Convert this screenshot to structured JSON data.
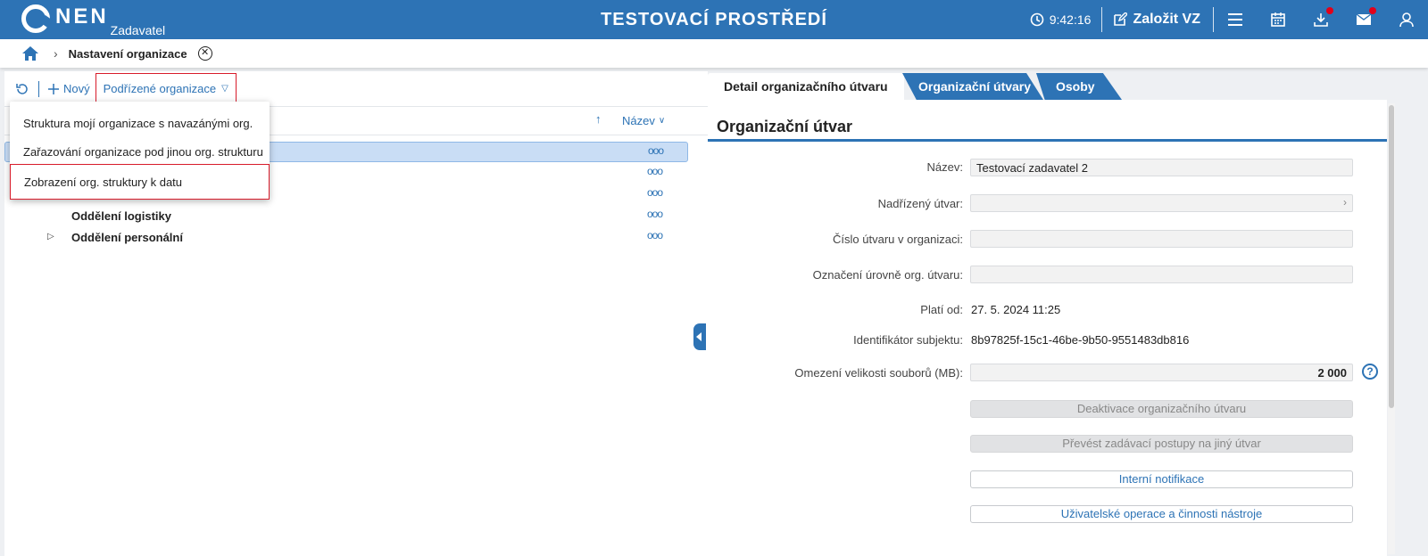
{
  "app": {
    "logo_text": "NEN",
    "logo_subtitle": "Zadavatel",
    "environment_title": "TESTOVACÍ PROSTŘEDÍ",
    "time": "9:42:16",
    "create_label": "Založit VZ",
    "icons": [
      "clock-icon",
      "edit-icon",
      "menu-icon",
      "calendar-icon",
      "download-icon",
      "mail-icon",
      "user-icon"
    ]
  },
  "breadcrumb": {
    "current": "Nastavení organizace"
  },
  "toolbar": {
    "new_label": "Nový",
    "subordinate_label": "Podřízené organizace"
  },
  "tree": {
    "sort_label": "Název",
    "rows": [
      {
        "label": "",
        "toggle": false,
        "selected": true
      },
      {
        "label": "",
        "toggle": false,
        "selected": false
      },
      {
        "label": "",
        "toggle": false,
        "selected": false
      },
      {
        "label": "Oddělení logistiky",
        "toggle": false,
        "selected": false
      },
      {
        "label": "Oddělení personální",
        "toggle": true,
        "selected": false
      }
    ],
    "more_symbol": "ooo"
  },
  "dropdown": {
    "items": [
      "Struktura mojí organizace s navazánými org.",
      "Zařazování organizace pod jinou org. strukturu",
      "Zobrazení org. struktury k datu"
    ]
  },
  "tabs": [
    "Detail organizačního útvaru",
    "Organizační útvary",
    "Osoby"
  ],
  "detail": {
    "section_title": "Organizační útvar",
    "fields": {
      "nazev_label": "Název:",
      "nazev_value": "Testovací zadavatel 2",
      "nadrizeny_label": "Nadřízený útvar:",
      "cislo_label": "Číslo útvaru v organizaci:",
      "oznaceni_label": "Označení úrovně org. útvaru:",
      "plati_label": "Platí od:",
      "plati_value": "27. 5. 2024 11:25",
      "identifikator_label": "Identifikátor subjektu:",
      "identifikator_value": "8b97825f-15c1-46be-9b50-9551483db816",
      "omezeni_label": "Omezení velikosti souborů (MB):",
      "omezeni_value": "2 000"
    },
    "buttons": {
      "deaktivace": "Deaktivace organizačního útvaru",
      "prevest": "Převést zadávací postupy na jiný útvar",
      "notifikace": "Interní notifikace",
      "operace": "Uživatelské operace a činnosti nástroje"
    }
  },
  "colors": {
    "brand": "#2d73b5",
    "highlight": "#d81b2a",
    "selected_row": "#c9ddf5"
  }
}
